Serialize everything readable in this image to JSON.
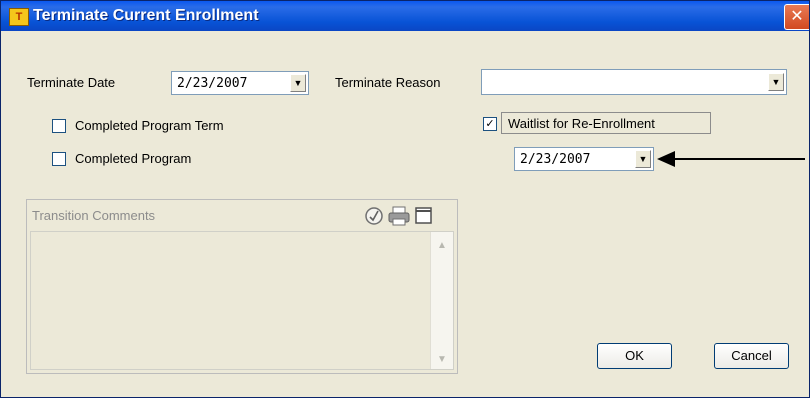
{
  "window": {
    "title": "Terminate Current Enrollment",
    "close_glyph": "✕",
    "app_icon_glyph": "T"
  },
  "form": {
    "terminate_date_label": "Terminate Date",
    "terminate_date_value": "2/23/2007",
    "terminate_reason_label": "Terminate Reason",
    "terminate_reason_value": "",
    "completed_program_term_label": "Completed Program Term",
    "completed_program_term_checked": false,
    "completed_program_label": "Completed Program",
    "completed_program_checked": false,
    "waitlist_label": "Waitlist for Re-Enrollment",
    "waitlist_checked": true,
    "waitlist_date_value": "2/23/2007"
  },
  "comments": {
    "title": "Transition Comments",
    "icons": [
      "spellcheck-icon",
      "print-icon",
      "expand-icon"
    ]
  },
  "buttons": {
    "ok": "OK",
    "cancel": "Cancel"
  },
  "colors": {
    "title_bar": "#0a58f0",
    "dialog_bg": "#ece9d8",
    "close_button": "#d24a20"
  }
}
